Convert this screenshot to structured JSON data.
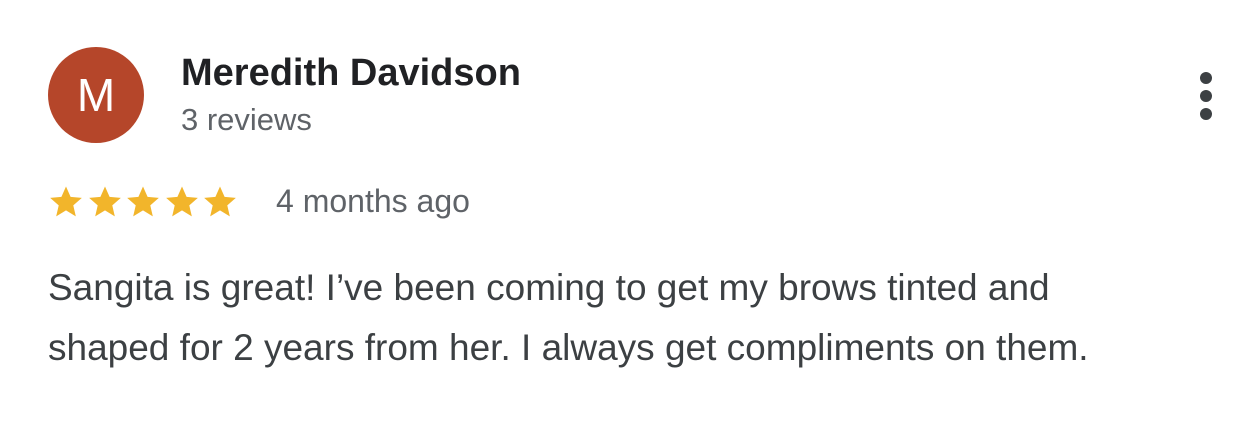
{
  "reviewer": {
    "avatar_letter": "M",
    "avatar_color": "#b5462a",
    "name": "Meredith Davidson",
    "review_count": "3 reviews"
  },
  "review": {
    "rating": 5,
    "rating_max": 5,
    "star_color": "#f2b52b",
    "time_ago": "4 months ago",
    "text_lines": [
      "Sangita is great! I’ve been coming to get my brows tinted and",
      "shaped for 2 years from her. I always get compliments on them."
    ]
  },
  "menu": {
    "icon": "more-vert-icon"
  }
}
